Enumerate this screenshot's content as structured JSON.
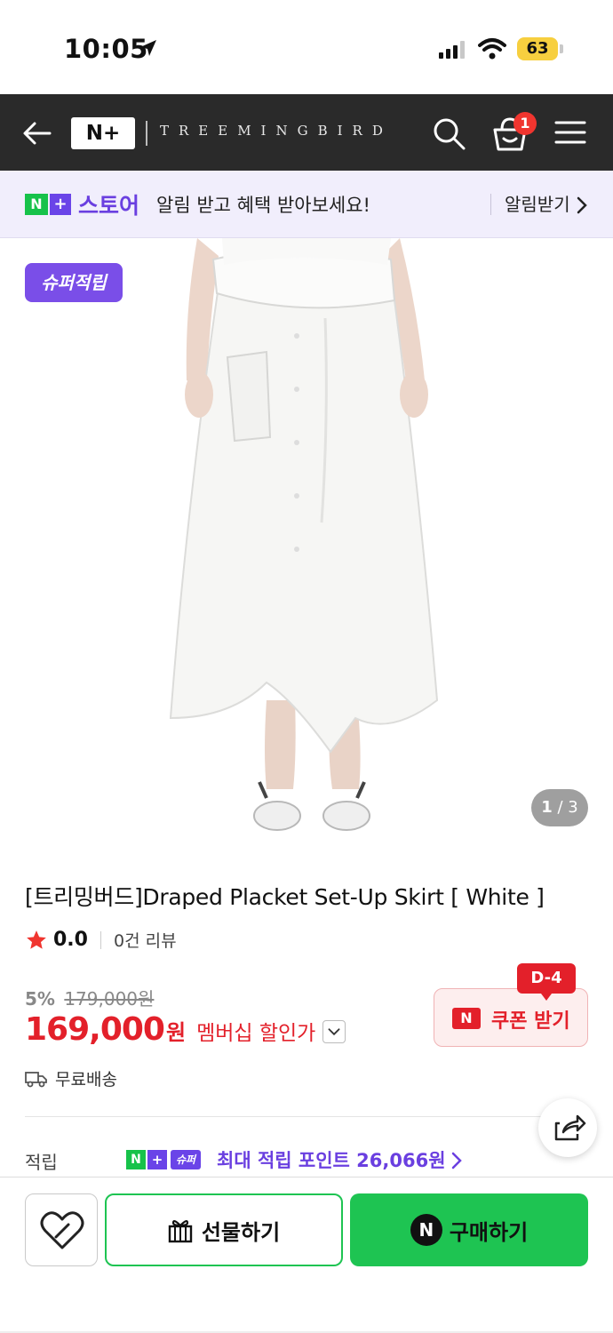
{
  "status_bar": {
    "time": "10:05",
    "battery": "63"
  },
  "header": {
    "brand_logo": "N+",
    "brand_name": "TREEMINGBIRD",
    "cart_count": "1"
  },
  "notice": {
    "store_logo": "N+",
    "store_word": "스토어",
    "message": "알림 받고 혜택 받아보세요!",
    "action": "알림받기"
  },
  "product": {
    "badge": "슈퍼적립",
    "page_current": "1",
    "page_total": "3",
    "title": "[트리밍버드]Draped Placket Set-Up Skirt [ White ]",
    "rating": "0.0",
    "review_count": "0건 리뷰",
    "discount_pct": "5%",
    "original_price": "179,000원",
    "price": "169,000",
    "price_unit": "원",
    "member_label": "멤버십 할인가",
    "coupon": {
      "d_badge": "D-4",
      "icon": "N",
      "label": "쿠폰 받기"
    },
    "shipping": "무료배송",
    "points": {
      "label": "적립",
      "super_tag": "슈퍼",
      "text": "최대 적립 포인트 26,066원"
    }
  },
  "bottom_bar": {
    "gift_label": "선물하기",
    "buy_icon": "N",
    "buy_label": "구매하기"
  },
  "colors": {
    "header_bg": "#2a2a2a",
    "npay_green": "#17c24a",
    "plus_purple": "#6a44e8",
    "price_red": "#e3202a",
    "buy_green": "#1ec452"
  }
}
